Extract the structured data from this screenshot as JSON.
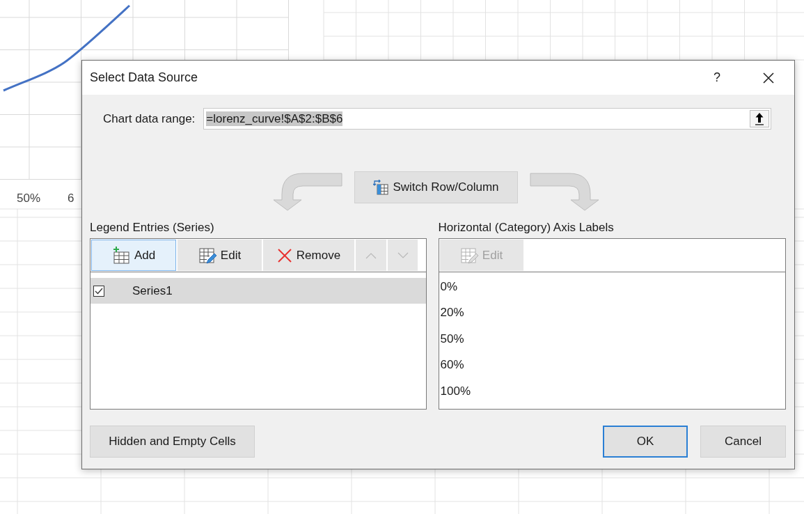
{
  "sheet": {
    "axis_labels": [
      "50%",
      "6"
    ]
  },
  "dialog": {
    "title": "Select Data Source",
    "help": "?",
    "data_range": {
      "label": "Chart data range:",
      "value": "=lorenz_curve!$A$2:$B$6",
      "selected": true
    },
    "switch_button": "Switch Row/Column",
    "legend": {
      "heading": "Legend Entries (Series)",
      "buttons": [
        {
          "kind": "add",
          "label": "Add",
          "focused": true,
          "disabled": false
        },
        {
          "kind": "edit",
          "label": "Edit",
          "focused": false,
          "disabled": false
        },
        {
          "kind": "remove",
          "label": "Remove",
          "focused": false,
          "disabled": false
        },
        {
          "kind": "up",
          "focused": false,
          "disabled": true
        },
        {
          "kind": "down",
          "focused": false,
          "disabled": true
        }
      ],
      "series": [
        {
          "name": "Series1",
          "checked": true,
          "selected": true
        }
      ]
    },
    "axis": {
      "heading": "Horizontal (Category) Axis Labels",
      "edit": {
        "label": "Edit",
        "disabled": true
      },
      "labels": [
        "0%",
        "20%",
        "50%",
        "60%",
        "100%"
      ]
    },
    "footer": {
      "hidden_cells": "Hidden and Empty Cells",
      "ok": {
        "label": "OK",
        "default": true
      },
      "cancel": {
        "label": "Cancel",
        "default": false
      }
    }
  }
}
